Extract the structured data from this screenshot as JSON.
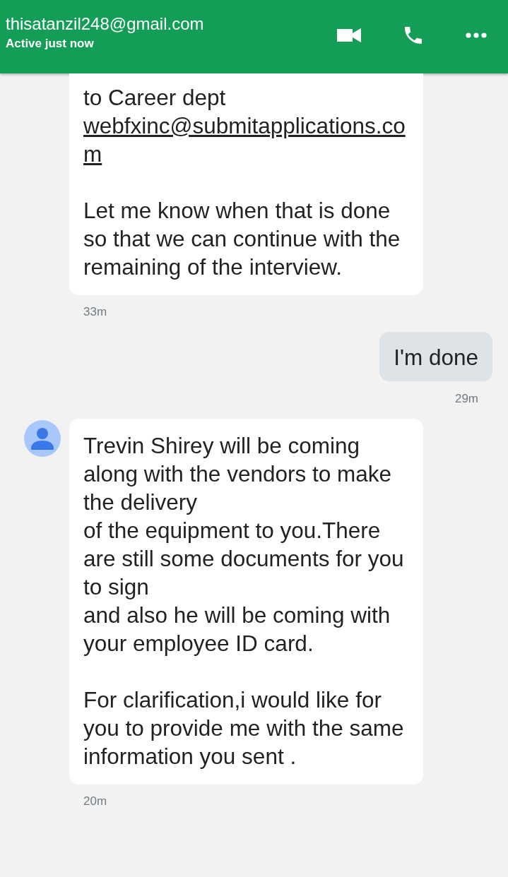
{
  "header": {
    "title": "thisatanzil248@gmail.com",
    "status": "Active just now"
  },
  "messages": [
    {
      "kind": "incoming",
      "avatar": false,
      "paragraphs": [
        [
          {
            "kind": "text",
            "text": "to Career dept"
          },
          {
            "kind": "link",
            "text": "webfxinc@submitapplications.com"
          }
        ],
        [
          {
            "kind": "text",
            "text": "Let me know when that is done so that we can continue with the\nremaining of the interview."
          }
        ]
      ],
      "time": "33m"
    },
    {
      "kind": "outgoing",
      "paragraphs": [
        [
          {
            "kind": "text",
            "text": "I'm done"
          }
        ]
      ],
      "time": "29m"
    },
    {
      "kind": "incoming",
      "avatar": true,
      "paragraphs": [
        [
          {
            "kind": "text",
            "text": "Trevin Shirey will be coming along with the vendors to make the delivery\nof the equipment to you.There are still some documents for you to sign\nand also he will be coming with your employee ID card."
          }
        ],
        [
          {
            "kind": "text",
            "text": "For clarification,i would like for you to provide me with the same\ninformation you sent ."
          }
        ]
      ],
      "time": "20m"
    }
  ]
}
